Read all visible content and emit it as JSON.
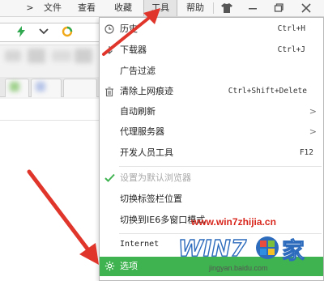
{
  "menubar": {
    "chevron": ">",
    "items": [
      "文件",
      "查看",
      "收藏",
      "工具",
      "帮助"
    ],
    "active_index": 3,
    "window_buttons": [
      "shirt-icon",
      "minimize-icon",
      "restore-icon",
      "close-icon"
    ]
  },
  "toolbar": {
    "icons": [
      "lightning-icon",
      "chevron-down-icon",
      "search-logo-icon"
    ]
  },
  "tools_menu": {
    "items": [
      {
        "icon": "clock-icon",
        "label": "历史",
        "shortcut": "Ctrl+H"
      },
      {
        "icon": "download-icon",
        "label": "下载器",
        "shortcut": "Ctrl+J"
      },
      {
        "icon": "",
        "label": "广告过滤",
        "shortcut": ""
      },
      {
        "icon": "trash-icon",
        "label": "清除上网痕迹",
        "shortcut": "Ctrl+Shift+Delete"
      },
      {
        "icon": "",
        "label": "自动刷新",
        "shortcut": "",
        "submenu": true
      },
      {
        "icon": "",
        "label": "代理服务器",
        "shortcut": "",
        "submenu": true
      },
      {
        "icon": "",
        "label": "开发人员工具",
        "shortcut": "F12"
      },
      {
        "icon": "check-icon",
        "label": "设置为默认浏览器",
        "shortcut": "",
        "disabled": true
      },
      {
        "icon": "",
        "label": "切换标签栏位置",
        "shortcut": ""
      },
      {
        "icon": "",
        "label": "切换到IE6多窗口模式",
        "shortcut": ""
      },
      {
        "icon": "",
        "label": "Internet",
        "shortcut": ""
      },
      {
        "icon": "gear-icon",
        "label": "选项",
        "shortcut": "",
        "highlighted": true
      }
    ],
    "submenu_arrow": ">"
  },
  "watermark": {
    "site": "www.win7zhijia.cn",
    "logo_text": "WIN7",
    "logo_char": "家",
    "sub": "jingyan.baidu.com"
  },
  "colors": {
    "highlight": "#3eb34f",
    "arrow": "#e0352b",
    "watermark_red": "#d8261c"
  }
}
